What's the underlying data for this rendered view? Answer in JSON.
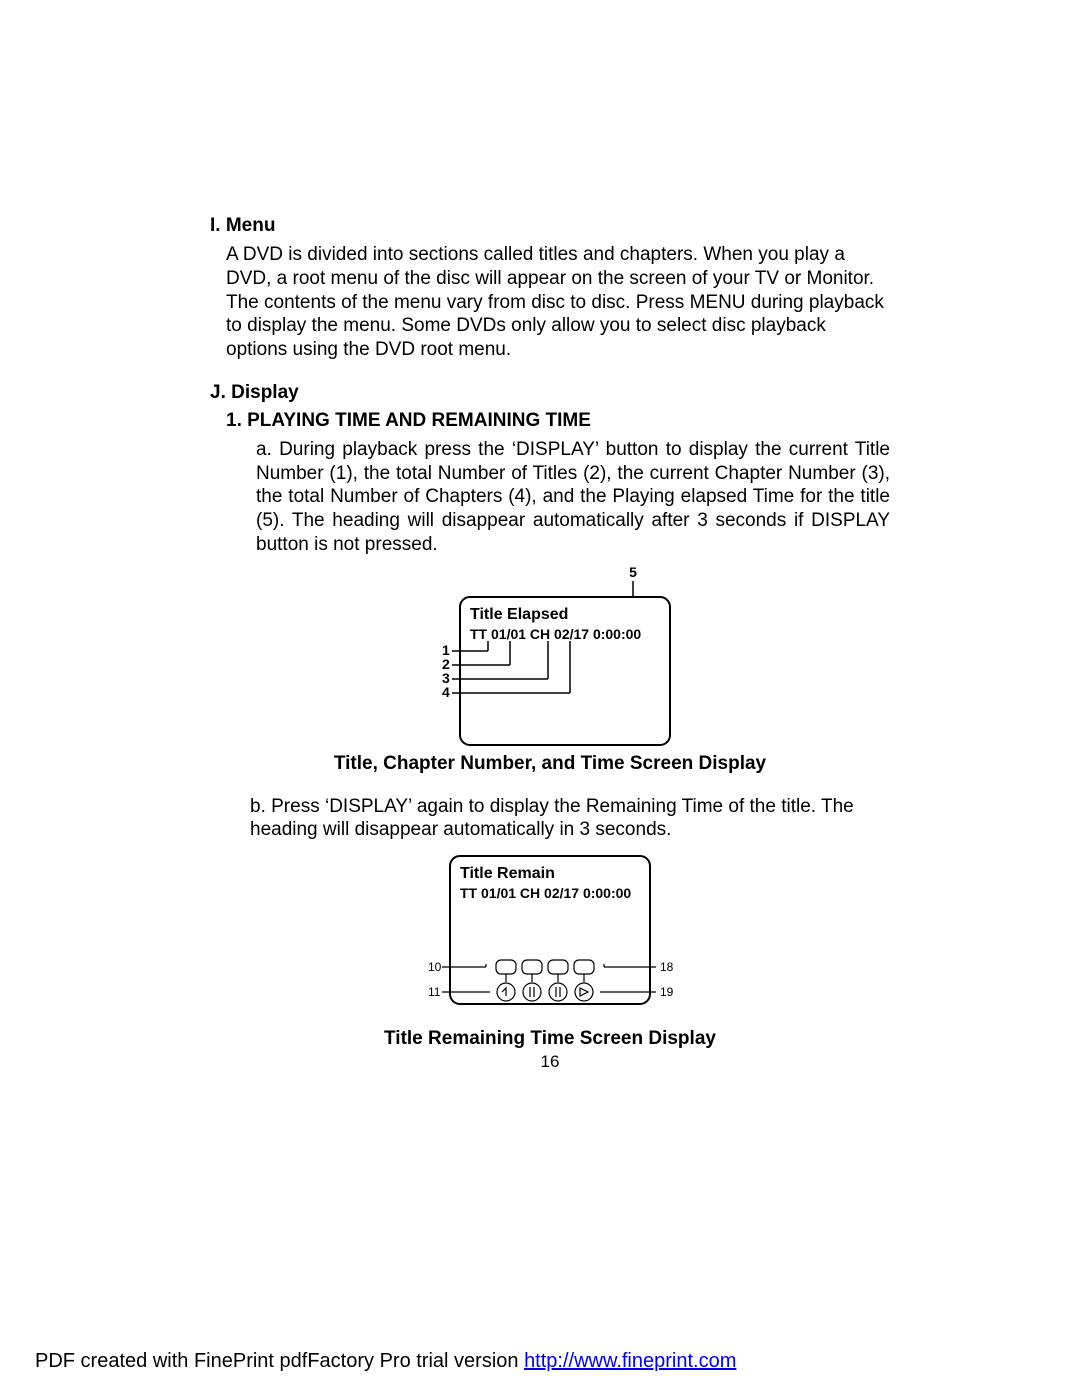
{
  "section_I": {
    "heading": "I. Menu",
    "body": "A DVD is divided into sections called titles and chapters. When you play a DVD, a root menu of the disc will appear on the screen of your TV or Monitor. The contents of the menu vary from disc to disc. Press MENU during playback to display the menu. Some DVDs only allow you to select disc playback options using the DVD root menu."
  },
  "section_J": {
    "heading": "J. Display",
    "sub1_heading": "1. PLAYING TIME AND REMAINING TIME",
    "item_a": "a. During playback press the ‘DISPLAY’  button to display the cur­rent  Title Number (1), the total Number of Titles (2), the current Chapter Number (3), the total Number of Chapters (4), and the Playing  elapsed Time for the title (5). The heading will disappear automatically after 3 seconds if DISPLAY button is not pressed.",
    "fig1": {
      "labels": {
        "l1": "1",
        "l2": "2",
        "l3": "3",
        "l4": "4",
        "l5": "5"
      },
      "line1": "Title Elapsed",
      "line2": "TT 01/01  CH 02/17  0:00:00",
      "caption": "Title, Chapter Number, and Time Screen Display"
    },
    "item_b": "b. Press ‘DISPLAY’ again to display the Remaining Time of  the title. The heading will disappear automatically  in 3 seconds.",
    "fig2": {
      "line1": "Title Remain",
      "line2": "TT 01/01  CH 02/17  0:00:00",
      "leftLabels": {
        "a": "10",
        "b": "11"
      },
      "rightLabels": {
        "a": "18",
        "b": "19"
      },
      "caption": "Title Remaining Time Screen Display"
    }
  },
  "page_number": "16",
  "footer": {
    "prefix": "PDF created with FinePrint pdfFactory Pro trial version ",
    "link_text": "http://www.fineprint.com",
    "link_href": "http://www.fineprint.com"
  }
}
